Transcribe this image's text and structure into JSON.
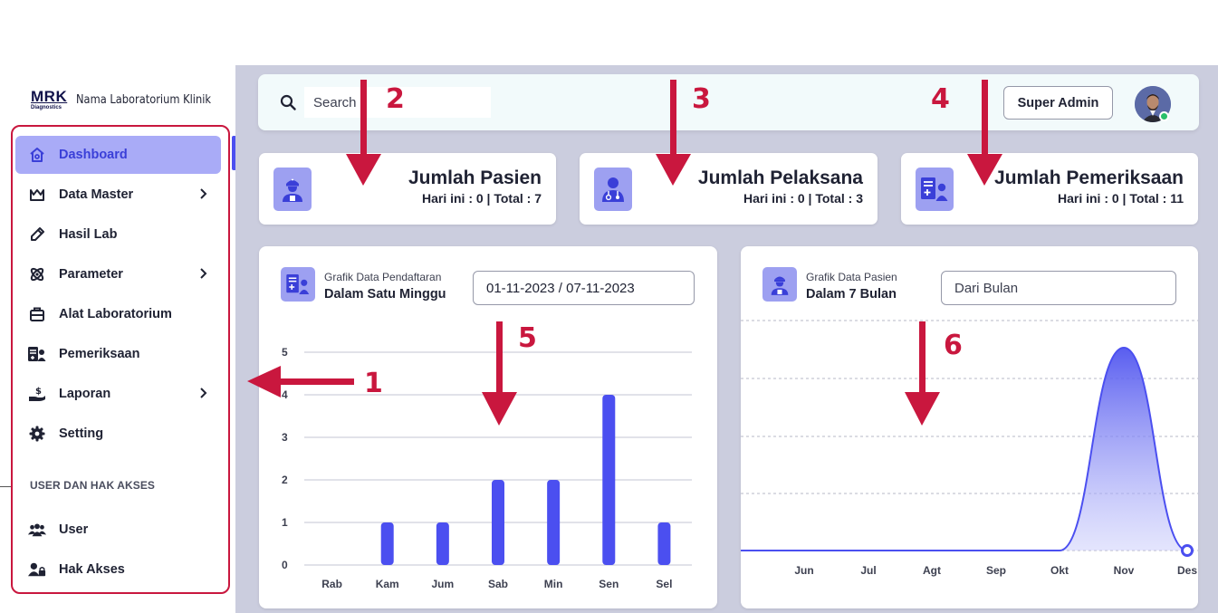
{
  "brand": {
    "logo_text": "MRK",
    "logo_sub": "Diagnostics",
    "name": "Nama Laboratorium Klinik"
  },
  "sidebar": {
    "items": [
      {
        "label": "Dashboard",
        "icon": "home-icon"
      },
      {
        "label": "Data Master",
        "icon": "crown-icon"
      },
      {
        "label": "Hasil Lab",
        "icon": "pen-icon"
      },
      {
        "label": "Parameter",
        "icon": "atom-icon"
      },
      {
        "label": "Alat Laboratorium",
        "icon": "briefcase-icon"
      },
      {
        "label": "Pemeriksaan",
        "icon": "id-card-icon"
      },
      {
        "label": "Laporan",
        "icon": "hand-dollar-icon"
      },
      {
        "label": "Setting",
        "icon": "gear-icon"
      }
    ],
    "section_label": "USER DAN HAK AKSES",
    "user_items": [
      {
        "label": "User",
        "icon": "users-icon"
      },
      {
        "label": "Hak Akses",
        "icon": "user-lock-icon"
      }
    ]
  },
  "header": {
    "search_placeholder": "Search",
    "role_label": "Super Admin"
  },
  "stats": [
    {
      "title": "Jumlah Pasien",
      "sub": "Hari ini : 0 | Total : 7"
    },
    {
      "title": "Jumlah Pelaksana",
      "sub": "Hari ini : 0 | Total : 3"
    },
    {
      "title": "Jumlah Pemeriksaan",
      "sub": "Hari ini : 0 | Total : 11"
    }
  ],
  "charts": {
    "left": {
      "kicker": "Grafik Data Pendaftaran",
      "title": "Dalam Satu Minggu",
      "range_value": "01-11-2023 / 07-11-2023"
    },
    "right": {
      "kicker": "Grafik Data Pasien",
      "title": "Dalam 7 Bulan",
      "range_placeholder": "Dari Bulan"
    }
  },
  "annotations": [
    "1",
    "2",
    "3",
    "4",
    "5",
    "6"
  ],
  "colors": {
    "accent": "#4b4ff0",
    "annotation": "#c9173e",
    "main_bg": "#cbcdde",
    "icon_bg": "#9da0f1"
  },
  "chart_data": [
    {
      "type": "bar",
      "categories": [
        "Rab",
        "Kam",
        "Jum",
        "Sab",
        "Min",
        "Sen",
        "Sel"
      ],
      "values": [
        0,
        1,
        1,
        2,
        2,
        4,
        1
      ],
      "ylim": [
        0,
        5
      ],
      "yticks": [
        "0",
        "1",
        "2",
        "3",
        "4",
        "5"
      ],
      "grid": true
    },
    {
      "type": "area",
      "categories": [
        "Jun",
        "Jul",
        "Agt",
        "Sep",
        "Okt",
        "Nov",
        "Des"
      ],
      "values": [
        0,
        0,
        0,
        0,
        0,
        7,
        0
      ],
      "grid": true
    }
  ]
}
